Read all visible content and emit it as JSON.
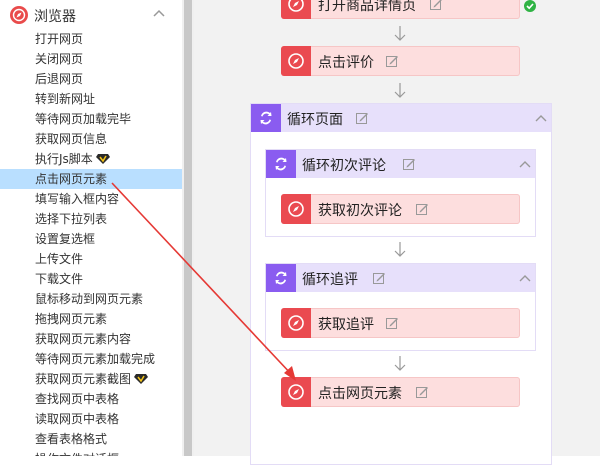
{
  "sidebar": {
    "title": "浏览器",
    "items": [
      {
        "label": "打开网页"
      },
      {
        "label": "关闭网页"
      },
      {
        "label": "后退网页"
      },
      {
        "label": "转到新网址"
      },
      {
        "label": "等待网页加载完毕"
      },
      {
        "label": "获取网页信息"
      },
      {
        "label": "执行Js脚本",
        "vip": true
      },
      {
        "label": "点击网页元素",
        "active": true
      },
      {
        "label": "填写输入框内容"
      },
      {
        "label": "选择下拉列表"
      },
      {
        "label": "设置复选框"
      },
      {
        "label": "上传文件"
      },
      {
        "label": "下载文件"
      },
      {
        "label": "鼠标移动到网页元素"
      },
      {
        "label": "拖拽网页元素"
      },
      {
        "label": "获取网页元素内容"
      },
      {
        "label": "等待网页元素加载完成"
      },
      {
        "label": "获取网页元素截图",
        "vip": true
      },
      {
        "label": "查找网页中表格"
      },
      {
        "label": "读取网页中表格"
      },
      {
        "label": "查看表格格式"
      },
      {
        "label": "操作文件对话框"
      }
    ]
  },
  "flow": {
    "step_open_detail": "打开商品详情页",
    "step_click_review": "点击评价",
    "loop_page": "循环页面",
    "loop_first_review": "循环初次评论",
    "step_get_first_review": "获取初次评论",
    "loop_follow_review": "循环追评",
    "step_get_follow_review": "获取追评",
    "step_click_element": "点击网页元素"
  },
  "colors": {
    "step_bg": "#fddede",
    "step_icon": "#ea4a50",
    "loop_head": "#e7e0fb",
    "loop_icon": "#8a5cf0",
    "active_item": "#b9dfff",
    "drag_arrow": "#e53935",
    "success": "#2fb344"
  },
  "icons": {
    "step": "compass-icon",
    "loop": "loop-icon",
    "edit": "edit-icon",
    "vip": "vip-diamond-icon",
    "status": "check-circle-icon"
  }
}
